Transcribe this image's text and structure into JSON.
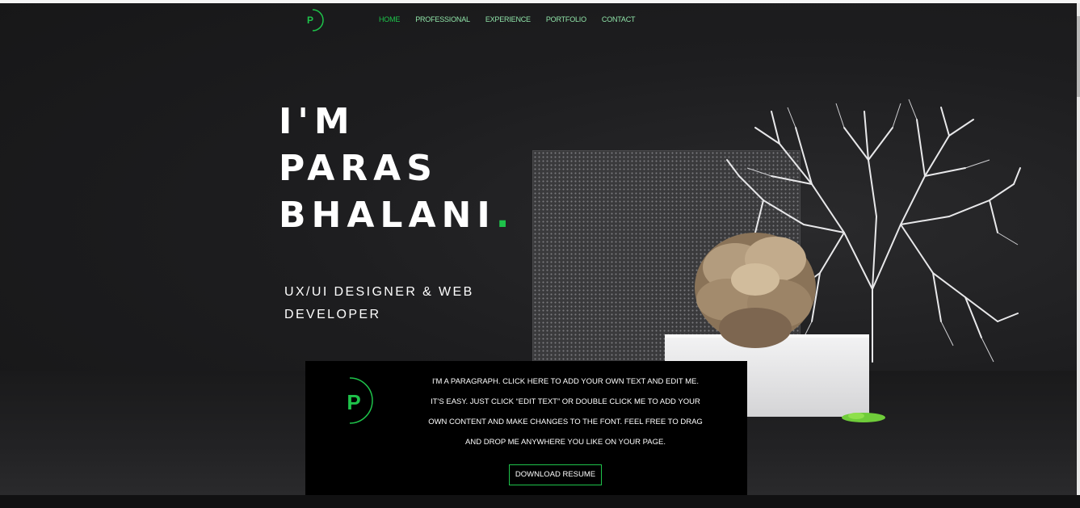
{
  "header": {
    "logo_letter": "P",
    "nav": [
      {
        "label": "HOME",
        "active": true
      },
      {
        "label": "PROFESSIONAL",
        "active": false
      },
      {
        "label": "EXPERIENCE",
        "active": false
      },
      {
        "label": "PORTFOLIO",
        "active": false
      },
      {
        "label": "CONTACT",
        "active": false
      }
    ]
  },
  "hero": {
    "headline_line1": "I'M",
    "headline_line2": "PARAS",
    "headline_line3": "BHALANI",
    "headline_dot": ".",
    "subtitle_line1": "UX/UI DESIGNER & WEB",
    "subtitle_line2": "DEVELOPER"
  },
  "card": {
    "logo_letter": "P",
    "paragraph_lines": [
      "I'M A PARAGRAPH. CLICK HERE TO ADD YOUR OWN TEXT AND EDIT ME.",
      "IT'S EASY. JUST CLICK “EDIT TEXT” OR DOUBLE CLICK ME TO ADD YOUR",
      "OWN CONTENT AND MAKE CHANGES TO THE FONT. FEEL FREE TO DRAG",
      "AND DROP ME ANYWHERE YOU LIKE ON YOUR PAGE."
    ],
    "download_label": "DOWNLOAD RESUME"
  },
  "colors": {
    "accent": "#1ec24a",
    "background": "#1c1c1e",
    "card_background": "#000000"
  }
}
